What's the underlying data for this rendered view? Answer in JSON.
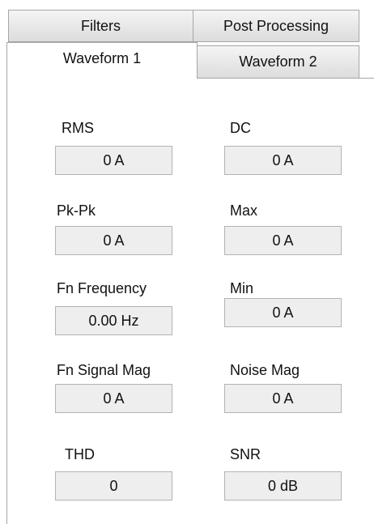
{
  "tabs": {
    "back_row": [
      "Filters",
      "Post Processing"
    ],
    "front_row": [
      "Waveform 1",
      "Waveform 2"
    ],
    "active": "Waveform 1"
  },
  "measurements": [
    {
      "label": "RMS",
      "value": "0 A"
    },
    {
      "label": "DC",
      "value": "0 A"
    },
    {
      "label": "Pk-Pk",
      "value": "0 A"
    },
    {
      "label": "Max",
      "value": "0 A"
    },
    {
      "label": "Fn Frequency",
      "value": "0.00 Hz"
    },
    {
      "label": "Min",
      "value": "0 A"
    },
    {
      "label": "Fn Signal Mag",
      "value": "0 A"
    },
    {
      "label": "Noise Mag",
      "value": "0 A"
    },
    {
      "label": "THD",
      "value": "0"
    },
    {
      "label": "SNR",
      "value": "0 dB"
    }
  ]
}
